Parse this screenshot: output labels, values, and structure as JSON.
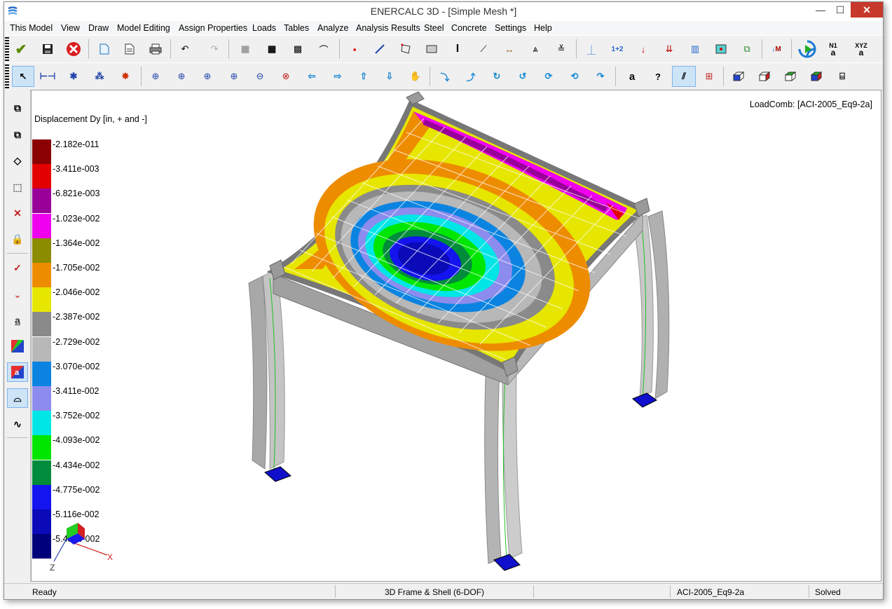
{
  "window": {
    "title": "ENERCALC 3D - [Simple Mesh *]",
    "minimize": "—",
    "maximize": "☐",
    "close": "✕"
  },
  "menu": [
    "This Model",
    "View",
    "Draw",
    "Model Editing",
    "Assign Properties",
    "Loads",
    "Tables",
    "Analyze",
    "Analysis Results",
    "Steel",
    "Concrete",
    "Settings",
    "Help"
  ],
  "toolbar1": {
    "add_node_label": "1+2",
    "node_label_icon": "N1",
    "coord_label_icon": "XYZ",
    "moment_label": "M"
  },
  "viewport": {
    "legend_title": "Displacement Dy [in, + and -]",
    "load_combination": "LoadComb: [ACI-2005_Eq9-2a]",
    "legend": [
      {
        "label": "-2.182e-011",
        "color": "#8b0000"
      },
      {
        "label": "-3.411e-003",
        "color": "#e30000"
      },
      {
        "label": "-6.821e-003",
        "color": "#990099"
      },
      {
        "label": "-1.023e-002",
        "color": "#ee00ee"
      },
      {
        "label": "-1.364e-002",
        "color": "#8c8c00"
      },
      {
        "label": "-1.705e-002",
        "color": "#ee8c00"
      },
      {
        "label": "-2.046e-002",
        "color": "#e6e600"
      },
      {
        "label": "-2.387e-002",
        "color": "#8a8a8a"
      },
      {
        "label": "-2.729e-002",
        "color": "#b8b8b8"
      },
      {
        "label": "-3.070e-002",
        "color": "#0a84e0"
      },
      {
        "label": "-3.411e-002",
        "color": "#8c8cee"
      },
      {
        "label": "-3.752e-002",
        "color": "#00e6e6"
      },
      {
        "label": "-4.093e-002",
        "color": "#00e600"
      },
      {
        "label": "-4.434e-002",
        "color": "#008c3a"
      },
      {
        "label": "-4.775e-002",
        "color": "#1414ee"
      },
      {
        "label": "-5.116e-002",
        "color": "#0a0ab8"
      },
      {
        "label": "-5.457e-002",
        "color": "#00007a"
      }
    ],
    "axis_labels": {
      "x": "X",
      "z": "Z"
    }
  },
  "status": {
    "ready": "Ready",
    "mode": "3D Frame & Shell (6-DOF)",
    "combination": "ACI-2005_Eq9-2a",
    "state": "Solved"
  }
}
